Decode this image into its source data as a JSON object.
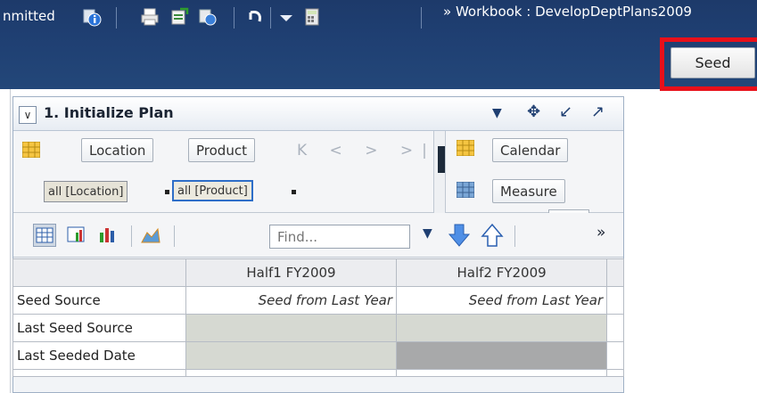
{
  "topbar": {
    "committed_label": "nmitted",
    "workbook_title": "» Workbook : DevelopDeptPlans2009",
    "seed_button": "Seed",
    "icons": [
      "info-icon",
      "print-icon",
      "export-excel-icon",
      "refresh-icon",
      "undo-icon",
      "dropdown-icon",
      "calculator-icon"
    ]
  },
  "panel": {
    "collapse_glyph": "∨",
    "title": "1. Initialize Plan",
    "head_icons": [
      "▼",
      "✥",
      "↙",
      "↗"
    ],
    "dimensions": {
      "rows_buttons": [
        "Location",
        "Product"
      ],
      "column_buttons": [
        "Calendar",
        "Measure"
      ],
      "nav_arrows": "K < > >|",
      "filters": [
        "all [Location]",
        "all [Product]"
      ]
    },
    "toolbar": {
      "find_placeholder": "Find...",
      "more_glyph": "»"
    },
    "table": {
      "columns": [
        "Half1 FY2009",
        "Half2 FY2009"
      ],
      "rows": [
        {
          "label": "Seed Source",
          "values": [
            "Seed from Last Year",
            "Seed from Last Year"
          ]
        },
        {
          "label": "Last Seed Source",
          "values": [
            "",
            ""
          ]
        },
        {
          "label": "Last Seeded Date",
          "values": [
            "",
            ""
          ]
        }
      ]
    }
  }
}
